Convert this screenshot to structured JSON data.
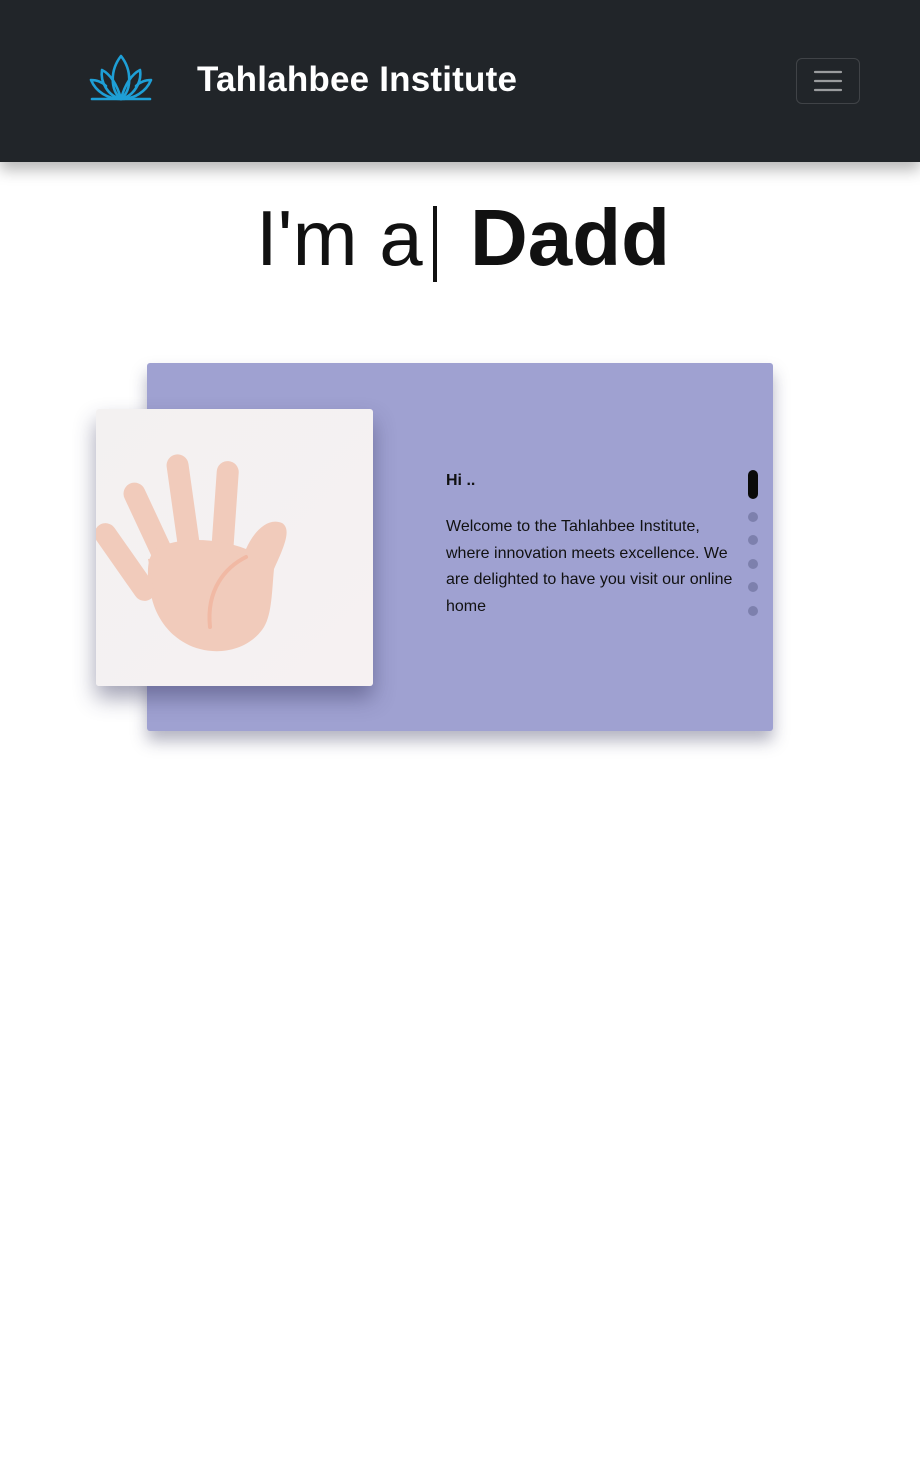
{
  "navbar": {
    "brand_name": "Tahlahbee Institute",
    "logo_icon": "lotus-icon",
    "toggler_icon": "hamburger-menu-icon",
    "colors": {
      "background": "#212529",
      "logo": "#1e9fd6"
    }
  },
  "hero": {
    "prefix": "I'm a",
    "typed_word": "Dadd"
  },
  "card": {
    "image_icon": "waving-hand-icon",
    "greeting": "Hi ..",
    "welcome_text": "Welcome to the Tahlahbee Institute, where innovation meets excellence. We are delighted to have you visit our online home",
    "slides_total": 6,
    "active_slide": 1,
    "colors": {
      "background": "#9fa1d1",
      "dot": "#7d80ad",
      "dot_active": "#0a0a0a"
    }
  }
}
